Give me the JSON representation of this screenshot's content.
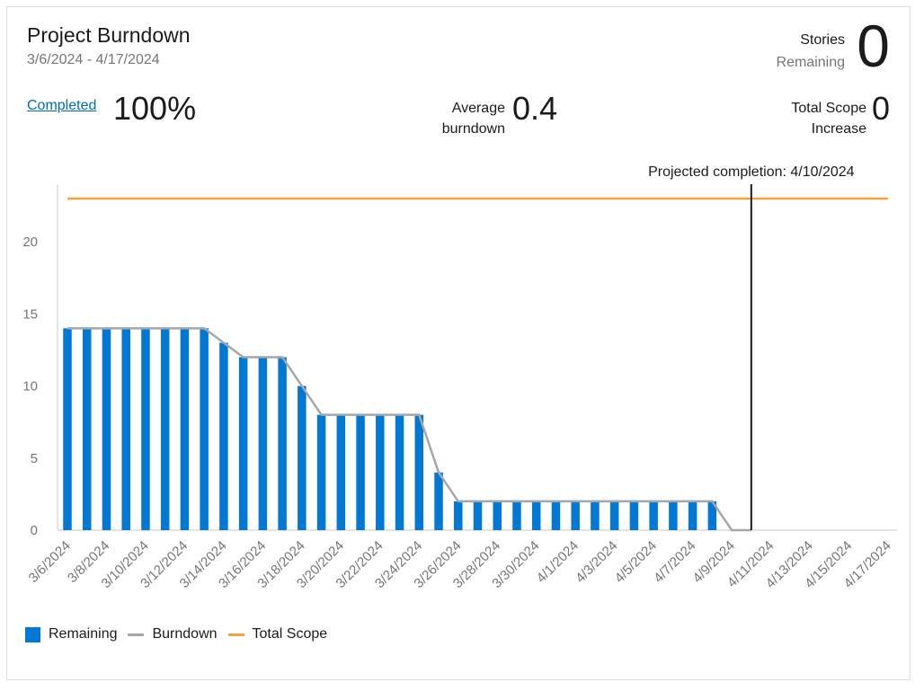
{
  "header": {
    "title": "Project Burndown",
    "date_range": "3/6/2024 - 4/17/2024",
    "stories_label_1": "Stories",
    "stories_label_2": "Remaining",
    "stories_value": "0"
  },
  "metrics": {
    "completed_label": "Completed",
    "completed_value": "100%",
    "avg_label_1": "Average",
    "avg_label_2": "burndown",
    "avg_value": "0.4",
    "scope_label_1": "Total Scope",
    "scope_label_2": "Increase",
    "scope_value": "0"
  },
  "colors": {
    "remaining": "#0078d4",
    "burndown": "#a6a6a6",
    "total_scope": "#f7a13b",
    "projection": "#1b1b1b"
  },
  "legend": [
    {
      "label": "Remaining",
      "kind": "box",
      "color": "#0078d4"
    },
    {
      "label": "Burndown",
      "kind": "line",
      "color": "#a6a6a6"
    },
    {
      "label": "Total Scope",
      "kind": "line",
      "color": "#f7a13b"
    }
  ],
  "chart_data": {
    "type": "bar",
    "title": "",
    "xlabel": "",
    "ylabel": "",
    "ylim": [
      0,
      24
    ],
    "yticks": [
      0,
      5,
      10,
      15,
      20
    ],
    "x_tick_labels": [
      "3/6/2024",
      "3/8/2024",
      "3/10/2024",
      "3/12/2024",
      "3/14/2024",
      "3/16/2024",
      "3/18/2024",
      "3/20/2024",
      "3/22/2024",
      "3/24/2024",
      "3/26/2024",
      "3/28/2024",
      "3/30/2024",
      "4/1/2024",
      "4/3/2024",
      "4/5/2024",
      "4/7/2024",
      "4/9/2024",
      "4/11/2024",
      "4/13/2024",
      "4/15/2024",
      "4/17/2024"
    ],
    "series": [
      {
        "name": "Remaining",
        "kind": "bar",
        "values": [
          14,
          14,
          14,
          14,
          14,
          14,
          14,
          14,
          13,
          12,
          12,
          12,
          10,
          8,
          8,
          8,
          8,
          8,
          8,
          4,
          2,
          2,
          2,
          2,
          2,
          2,
          2,
          2,
          2,
          2,
          2,
          2,
          2,
          2
        ]
      },
      {
        "name": "Burndown",
        "kind": "line",
        "values": [
          14,
          14,
          14,
          14,
          14,
          14,
          14,
          14,
          13,
          12,
          12,
          12,
          10,
          8,
          8,
          8,
          8,
          8,
          8,
          4,
          2,
          2,
          2,
          2,
          2,
          2,
          2,
          2,
          2,
          2,
          2,
          2,
          2,
          2,
          0,
          0
        ]
      },
      {
        "name": "Total Scope",
        "kind": "line",
        "constant": 23
      }
    ],
    "annotation": {
      "label": "Projected completion: 4/10/2024",
      "date": "4/10/2024"
    },
    "grid": false,
    "legend_position": "bottom-left"
  }
}
